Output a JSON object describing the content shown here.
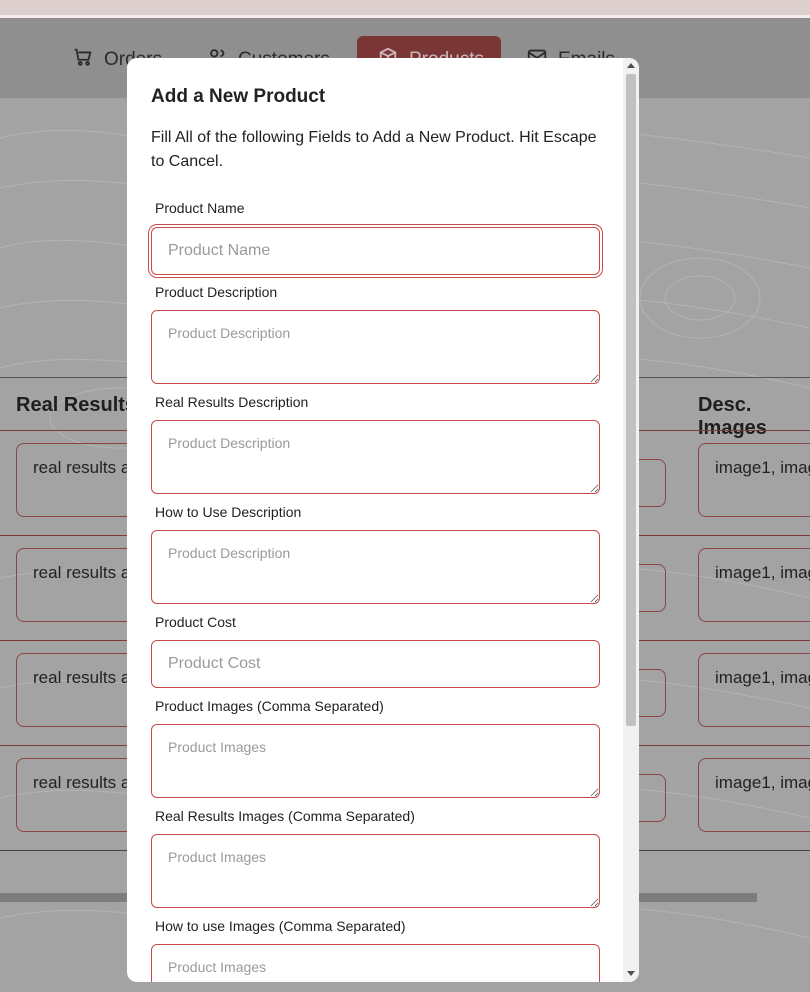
{
  "nav": {
    "items": [
      {
        "label": "Orders",
        "icon": "cart-icon"
      },
      {
        "label": "Customers",
        "icon": "users-icon"
      },
      {
        "label": "Products",
        "icon": "box-icon"
      },
      {
        "label": "Emails",
        "icon": "mail-icon"
      }
    ],
    "active": "Products"
  },
  "table": {
    "headers": {
      "real_results": "Real Results",
      "desc_images": "Desc. Images"
    },
    "rows": [
      {
        "real_results": "real results a",
        "desc_images": "image1, imag"
      },
      {
        "real_results": "real results a",
        "desc_images": "image1, imag"
      },
      {
        "real_results": "real results a",
        "desc_images": "image1, imag"
      },
      {
        "real_results": "real results a",
        "desc_images": "image1, imag"
      }
    ]
  },
  "modal": {
    "title": "Add a New Product",
    "description": "Fill All of the following Fields to Add a New Product. Hit Escape to Cancel.",
    "fields": {
      "product_name": {
        "label": "Product Name",
        "placeholder": "Product Name",
        "value": ""
      },
      "product_description": {
        "label": "Product Description",
        "placeholder": "Product Description",
        "value": ""
      },
      "real_results_description": {
        "label": "Real Results Description",
        "placeholder": "Product Description",
        "value": ""
      },
      "how_to_use_description": {
        "label": "How to Use Description",
        "placeholder": "Product Description",
        "value": ""
      },
      "product_cost": {
        "label": "Product Cost",
        "placeholder": "Product Cost",
        "value": ""
      },
      "product_images": {
        "label": "Product Images (Comma Separated)",
        "placeholder": "Product Images",
        "value": ""
      },
      "real_results_images": {
        "label": "Real Results Images (Comma Separated)",
        "placeholder": "Product Images",
        "value": ""
      },
      "how_to_use_images": {
        "label": "How to use Images (Comma Separated)",
        "placeholder": "Product Images",
        "value": ""
      }
    }
  },
  "colors": {
    "accent": "#c84a4a",
    "overlay": "#a3a3a3",
    "modal_bg": "#ffffff"
  }
}
